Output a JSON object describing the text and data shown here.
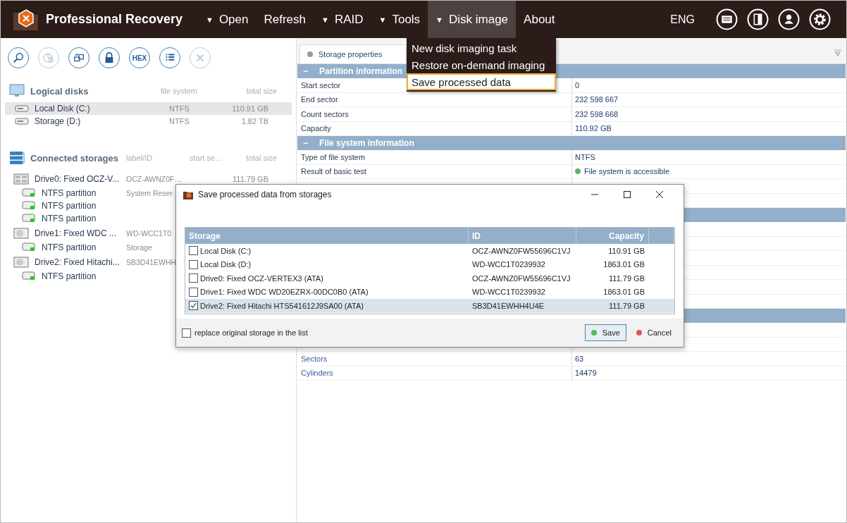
{
  "app": {
    "title": "Professional Recovery"
  },
  "menu": [
    {
      "label": "Open",
      "caret": "▼",
      "selected": false
    },
    {
      "label": "Refresh",
      "selected": false
    },
    {
      "label": "RAID",
      "caret": "▼",
      "selected": false
    },
    {
      "label": "Tools",
      "caret": "▼",
      "selected": false
    },
    {
      "label": "Disk image",
      "caret": "▼",
      "selected": true
    },
    {
      "label": "About",
      "selected": false
    }
  ],
  "language": "ENG",
  "dropdown": [
    {
      "label": "New disk imaging task",
      "selected": false
    },
    {
      "label": "Restore on-demand imaging",
      "selected": false
    },
    {
      "label": "Save processed data",
      "selected": true
    }
  ],
  "toolbar": [
    {
      "kind": "search",
      "disabled": false
    },
    {
      "kind": "chart",
      "disabled": true
    },
    {
      "kind": "scan",
      "disabled": false
    },
    {
      "kind": "lock",
      "disabled": false
    },
    {
      "kind": "hex",
      "label": "HEX",
      "disabled": false
    },
    {
      "kind": "list",
      "disabled": false
    },
    {
      "kind": "close",
      "disabled": true
    }
  ],
  "logical_disks": {
    "title": "Logical disks",
    "columns": [
      "file system",
      "total size"
    ],
    "items": [
      {
        "name": "Local Disk (C:)",
        "fs": "NTFS",
        "size": "110.91 GB",
        "selected": true
      },
      {
        "name": "Storage (D:)",
        "fs": "NTFS",
        "size": "1.82 TB",
        "selected": false
      }
    ]
  },
  "connected_storages": {
    "title": "Connected storages",
    "columns": [
      "label/ID",
      "start se…",
      "total size"
    ],
    "items": [
      {
        "kind": "ssd",
        "name": "Drive0: Fixed OCZ-V...",
        "label": "OCZ-AWNZ0F…",
        "size": "111.79 GB",
        "children": [
          {
            "name": "NTFS partition",
            "label": "System Reser"
          },
          {
            "name": "NTFS partition"
          },
          {
            "name": "NTFS partition"
          }
        ]
      },
      {
        "kind": "hdd",
        "name": "Drive1: Fixed WDC ...",
        "label": "WD-WCC1T0",
        "children": [
          {
            "name": "NTFS partition",
            "label": "Storage"
          }
        ]
      },
      {
        "kind": "hdd",
        "name": "Drive2: Fixed Hitachi...",
        "label": "SB3D41EWHH",
        "children": [
          {
            "name": "NTFS partition"
          }
        ]
      }
    ]
  },
  "properties": {
    "tab": "Storage properties",
    "sections": [
      {
        "title": "Partition information",
        "toggle": "−",
        "rows": [
          {
            "label": "Start sector",
            "value": "0"
          },
          {
            "label": "End sector",
            "value": "232 598 667"
          },
          {
            "label": "Count sectors",
            "value": "232 598 668"
          },
          {
            "label": "Capacity",
            "value": "110.92 GB"
          }
        ]
      },
      {
        "title": "File system information",
        "toggle": "−",
        "rows": [
          {
            "label": "Type of file system",
            "value": "NTFS"
          },
          {
            "label": "Result of basic test",
            "value": "File system is accessible",
            "color": "#5cb85c"
          }
        ]
      }
    ],
    "rows_below": [
      {
        "label": "Sectors",
        "value": "63"
      },
      {
        "label": "Cylinders",
        "value": "14479"
      }
    ]
  },
  "dialog": {
    "title": "Save processed data from storages",
    "columns": [
      "Storage",
      "ID",
      "Capacity"
    ],
    "rows": [
      {
        "storage": "Local Disk (C:)",
        "id": "OCZ-AWNZ0FW55696C1VJ",
        "capacity": "110.91 GB",
        "checked": false,
        "selected": false
      },
      {
        "storage": "Local Disk (D:)",
        "id": "WD-WCC1T0239932",
        "capacity": "1863.01 GB",
        "checked": false,
        "selected": false
      },
      {
        "storage": "Drive0: Fixed OCZ-VERTEX3 (ATA)",
        "id": "OCZ-AWNZ0FW55696C1VJ",
        "capacity": "111.79 GB",
        "checked": false,
        "selected": false
      },
      {
        "storage": "Drive1: Fixed WDC WD20EZRX-00DC0B0 (ATA)",
        "id": "WD-WCC1T0239932",
        "capacity": "1863.01 GB",
        "checked": false,
        "selected": false
      },
      {
        "storage": "Drive2: Fixed Hitachi HTS541612J9SA00 (ATA)",
        "id": "SB3D41EWHH4U4E",
        "capacity": "111.79 GB",
        "checked": true,
        "selected": true
      }
    ],
    "option": {
      "label": "replace original storage in the list",
      "checked": false
    },
    "buttons": [
      {
        "kind": "save",
        "label": "Save",
        "focused": true
      },
      {
        "kind": "cancel",
        "label": "Cancel",
        "focused": false
      }
    ]
  }
}
